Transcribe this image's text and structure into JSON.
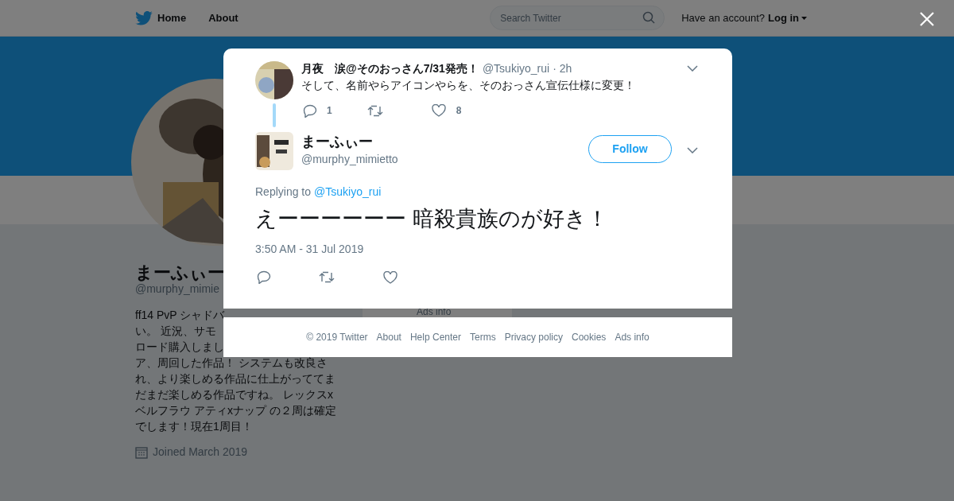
{
  "header": {
    "nav": [
      {
        "label": "Home"
      },
      {
        "label": "About"
      }
    ],
    "search": {
      "placeholder": "Search Twitter"
    },
    "account_prompt": "Have an account?",
    "login": "Log in"
  },
  "profile": {
    "name": "まーふぃー",
    "handle": "@murphy_mimie",
    "bio_lines": [
      "ff14 PvP シャドバ",
      "い。 近況、サモ",
      "ロード購入しまし",
      "ア、周回した作品！ システムも改良さ",
      "れ、より楽しめる作品に仕上がっててま",
      "だまだ楽しめる作品ですね。 レックスx",
      "ベルフラウ アティxナップ の２周は確定",
      "でします！現在1周目！"
    ],
    "joined": "Joined March 2019",
    "ads_info": "Ads info"
  },
  "modal": {
    "parent_tweet": {
      "name": "月夜　涙@そのおっさん7/31発売！",
      "handle": "@Tsukiyo_rui",
      "time": "· 2h",
      "text": "そして、名前やらアイコンやらを、そのおっさん宣伝仕様に変更！",
      "replies": "1",
      "likes": "8"
    },
    "tweet": {
      "name": "まーふぃー",
      "handle": "@murphy_mimietto",
      "follow": "Follow",
      "replying_prefix": "Replying to",
      "replying_to": "@Tsukiyo_rui",
      "text": "えーーーーーー 暗殺貴族のが好き！",
      "timestamp": "3:50 AM - 31 Jul 2019"
    },
    "footer": [
      "© 2019 Twitter",
      "About",
      "Help Center",
      "Terms",
      "Privacy policy",
      "Cookies",
      "Ads info"
    ]
  }
}
